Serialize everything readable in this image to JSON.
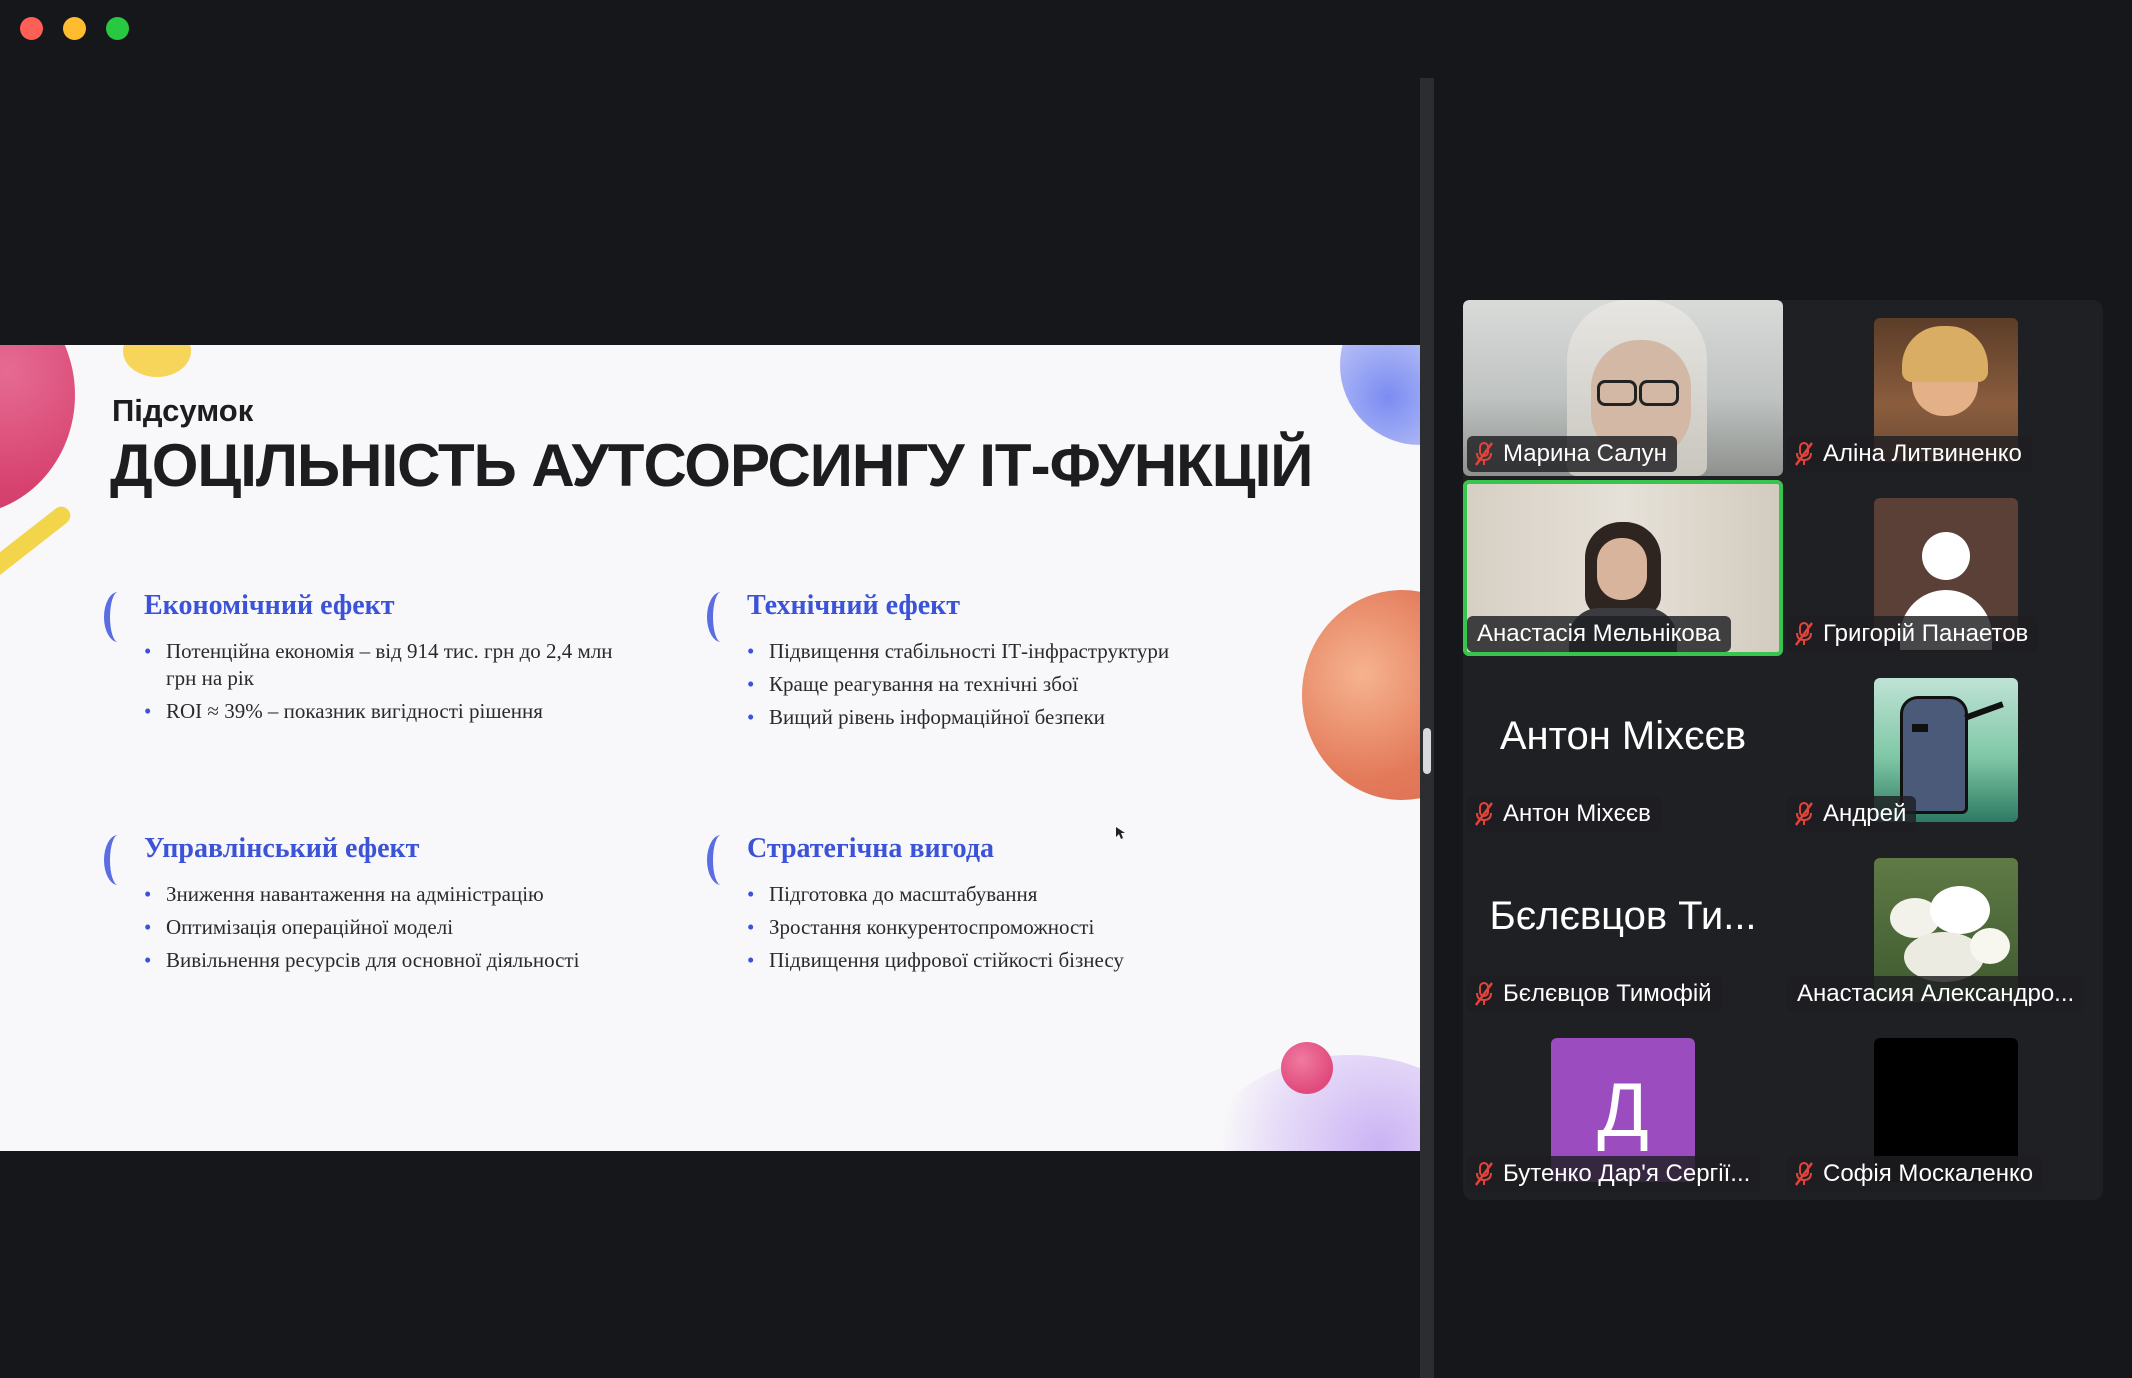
{
  "slide": {
    "subtitle": "Підсумок",
    "title": "ДОЦІЛЬНІСТЬ АУТСОРСИНГУ ІТ-ФУНКЦІЙ",
    "sections": [
      {
        "heading": "Економічний ефект",
        "items": [
          "Потенційна економія – від 914 тис. грн до 2,4 млн грн на рік",
          "ROI ≈ 39% – показник вигідності рішення"
        ]
      },
      {
        "heading": "Технічний ефект",
        "items": [
          "Підвищення стабільності ІТ-інфраструктури",
          "Краще реагування на технічні збої",
          "Вищий рівень інформаційної безпеки"
        ]
      },
      {
        "heading": "Управлінський ефект",
        "items": [
          "Зниження навантаження на адміністрацію",
          "Оптимізація операційної моделі",
          "Вивільнення ресурсів для основної діяльності"
        ]
      },
      {
        "heading": "Стратегічна вигода",
        "items": [
          "Підготовка до масштабування",
          "Зростання конкурентоспроможності",
          "Підвищення цифрової стійкості бізнесу"
        ]
      }
    ]
  },
  "participants": [
    {
      "name": "Марина Салун",
      "muted": true,
      "tile": "video"
    },
    {
      "name": "Аліна Литвиненко",
      "muted": true,
      "tile": "avatar-photo"
    },
    {
      "name": "Анастасія Мельнікова",
      "muted": false,
      "tile": "video",
      "active_speaker": true
    },
    {
      "name": "Григорій Панаетов",
      "muted": true,
      "tile": "avatar-default"
    },
    {
      "name": "Антон Міхєєв",
      "muted": true,
      "tile": "name-only",
      "big_label": "Антон Міхєєв"
    },
    {
      "name": "Андрей",
      "muted": true,
      "tile": "avatar-image"
    },
    {
      "name": "Бєлєвцов Тимофій",
      "muted": true,
      "tile": "name-only",
      "big_label": "Бєлєвцов Ти..."
    },
    {
      "name": "Анастасия Александро...",
      "muted": false,
      "tile": "avatar-image"
    },
    {
      "name": "Бутенко Дар'я Сергії...",
      "muted": true,
      "tile": "avatar-letter",
      "letter": "Д"
    },
    {
      "name": "Софія Москаленко",
      "muted": true,
      "tile": "avatar-black"
    }
  ],
  "colors": {
    "accent": "#3b53d8",
    "active_speaker": "#37c54e",
    "mic_muted": "#e2443a",
    "letter_avatar": "#9b4dc0"
  },
  "icons": {
    "mic": "mic-off-icon",
    "default_avatar": "person-icon"
  }
}
